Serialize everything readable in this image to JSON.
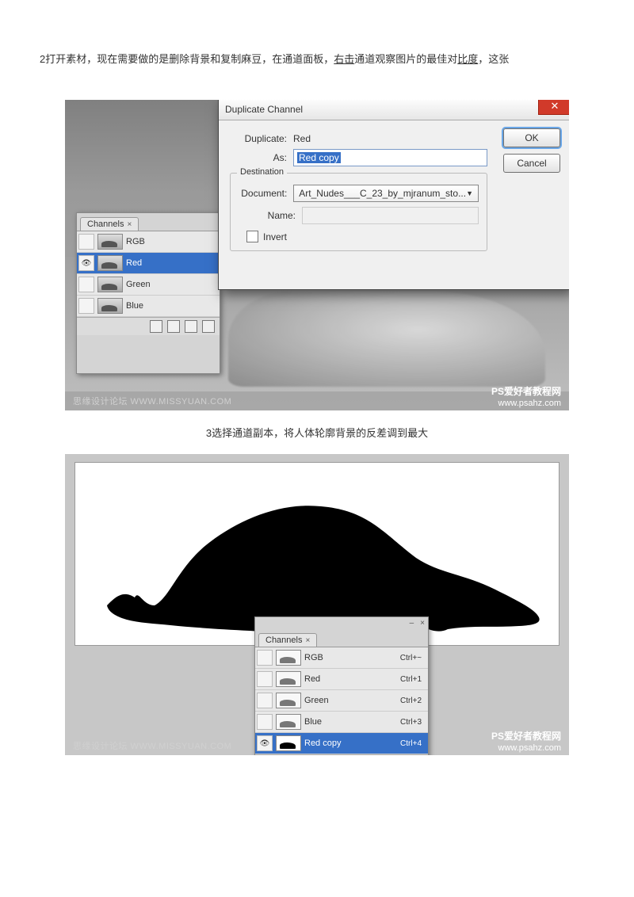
{
  "text": {
    "line1_prefix": "2打开素材，现在需要做的是删除背景和复制麻豆，在通道面板，",
    "line1_underlined1": "右击",
    "line1_mid": "通道观察图片的最佳对",
    "line1_underlined2": "比度",
    "line1_suffix": "，这张",
    "caption2": "3选择通道副本，将人体轮廓背景的反差调到最大"
  },
  "panel1": {
    "tab": "Channels",
    "rows": [
      {
        "label": "RGB",
        "selected": false,
        "eye": false
      },
      {
        "label": "Red",
        "selected": true,
        "eye": true
      },
      {
        "label": "Green",
        "selected": false,
        "eye": false
      },
      {
        "label": "Blue",
        "selected": false,
        "eye": false
      }
    ]
  },
  "dialog": {
    "title": "Duplicate Channel",
    "duplicate_label": "Duplicate:",
    "duplicate_value": "Red",
    "as_label": "As:",
    "as_value": "Red copy",
    "destination_legend": "Destination",
    "document_label": "Document:",
    "document_value": "Art_Nudes___C_23_by_mjranum_sto...",
    "name_label": "Name:",
    "name_value": "",
    "invert_label": "Invert",
    "ok": "OK",
    "cancel": "Cancel"
  },
  "panel2": {
    "tab": "Channels",
    "rows": [
      {
        "label": "RGB",
        "shortcut": "Ctrl+~",
        "selected": false,
        "eye": false,
        "thumb": "white"
      },
      {
        "label": "Red",
        "shortcut": "Ctrl+1",
        "selected": false,
        "eye": false,
        "thumb": "white"
      },
      {
        "label": "Green",
        "shortcut": "Ctrl+2",
        "selected": false,
        "eye": false,
        "thumb": "white"
      },
      {
        "label": "Blue",
        "shortcut": "Ctrl+3",
        "selected": false,
        "eye": false,
        "thumb": "white"
      },
      {
        "label": "Red copy",
        "shortcut": "Ctrl+4",
        "selected": true,
        "eye": true,
        "thumb": "black"
      }
    ]
  },
  "watermarks": {
    "left": "思缘设计论坛 WWW.MISSYUAN.COM",
    "right_line1": "PS爱好者教程网",
    "right_line2": "www.psahz.com"
  }
}
